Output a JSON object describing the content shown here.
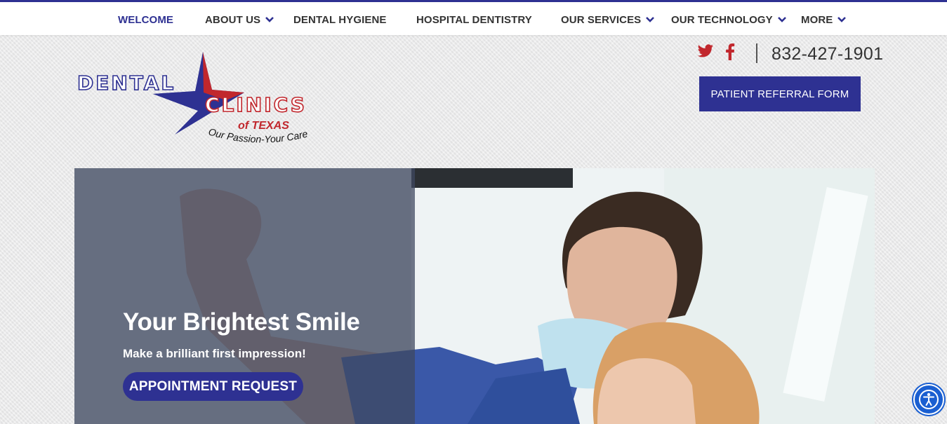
{
  "nav": {
    "items": [
      {
        "label": "WELCOME",
        "active": true
      },
      {
        "label": "ABOUT US",
        "dropdown": true
      },
      {
        "label": "DENTAL HYGIENE"
      },
      {
        "label": "HOSPITAL DENTISTRY"
      },
      {
        "label": "OUR SERVICES",
        "dropdown": true
      },
      {
        "label": "OUR TECHNOLOGY",
        "dropdown": true
      },
      {
        "label": "MORE",
        "dropdown": true
      }
    ]
  },
  "logo": {
    "line1": "DENTAL",
    "line2": "CLINICS",
    "line3": "of TEXAS",
    "tagline": "Our Passion-Your Care"
  },
  "header": {
    "social_icons": [
      "twitter-icon",
      "facebook-icon"
    ],
    "phone": "832-427-1901",
    "referral_button": "PATIENT REFERRAL FORM"
  },
  "hero": {
    "title": "Your Brightest Smile",
    "subtitle": "Make a brilliant first impression!",
    "cta": "APPOINTMENT REQUEST"
  },
  "accessibility": {
    "icon": "accessibility-icon"
  },
  "colors": {
    "brand_blue": "#2e3192",
    "brand_red": "#c1272d",
    "overlay": "#3e4860",
    "accessibility_blue": "#1a5fd1"
  }
}
